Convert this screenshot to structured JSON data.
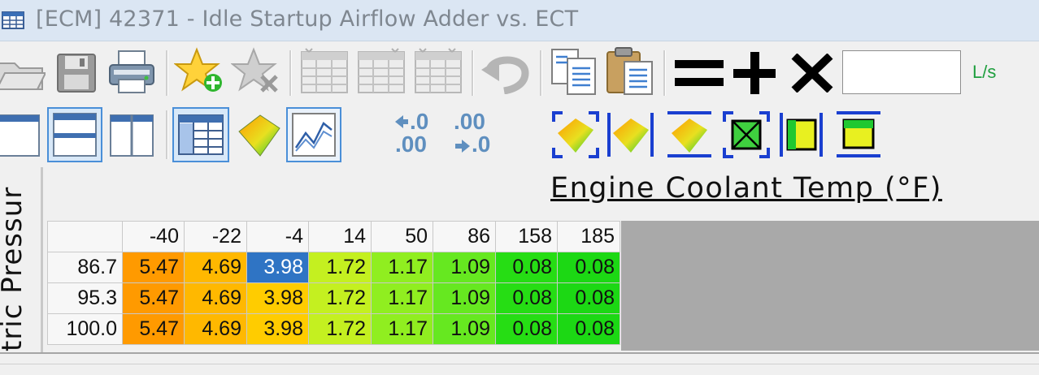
{
  "window": {
    "title": "[ECM] 42371 - Idle Startup Airflow Adder vs. ECT"
  },
  "toolbar": {
    "icons": [
      "open-icon",
      "save-icon",
      "print-icon",
      "add-favorite-icon",
      "remove-favorite-icon",
      "table-icon",
      "table-copy-icon",
      "table-paste-icon",
      "undo-icon",
      "copy-icon",
      "paste-icon",
      "equals-icon",
      "plus-icon",
      "multiply-icon"
    ],
    "value_input": "",
    "unit": "L/s"
  },
  "view_toolbar": {
    "icons": [
      "view-single-icon",
      "view-split-horizontal-icon",
      "view-split-vertical-icon",
      "table-view-icon",
      "3d-view-icon",
      "graph-view-icon",
      "decimal-decrease-icon",
      "decimal-increase-icon",
      "select-all-3d-icon",
      "select-column-3d-icon",
      "select-row-3d-icon",
      "select-cell-icon",
      "select-vertical-icon",
      "select-horizontal-icon"
    ],
    "decimal_labels": [
      ".0",
      ".00",
      ".00",
      ".0"
    ]
  },
  "map": {
    "x_axis_title": "Engine Coolant Temp (°F)",
    "y_axis_title": "tric Pressur",
    "columns": [
      "-40",
      "-22",
      "-4",
      "14",
      "50",
      "86",
      "158",
      "185"
    ],
    "rows": [
      {
        "label": "86.7",
        "cells": [
          "5.47",
          "4.69",
          "3.98",
          "1.72",
          "1.17",
          "1.09",
          "0.08",
          "0.08"
        ]
      },
      {
        "label": "95.3",
        "cells": [
          "5.47",
          "4.69",
          "3.98",
          "1.72",
          "1.17",
          "1.09",
          "0.08",
          "0.08"
        ]
      },
      {
        "label": "100.0",
        "cells": [
          "5.47",
          "4.69",
          "3.98",
          "1.72",
          "1.17",
          "1.09",
          "0.08",
          "0.08"
        ]
      }
    ],
    "column_colors": [
      "#ff9a00",
      "#ffb800",
      "#ffcc00",
      "#c4f020",
      "#90ee20",
      "#66e820",
      "#26dd14",
      "#1cd814"
    ],
    "selected_cell": {
      "row": 0,
      "col": 2,
      "color": "#2f74c4"
    }
  }
}
